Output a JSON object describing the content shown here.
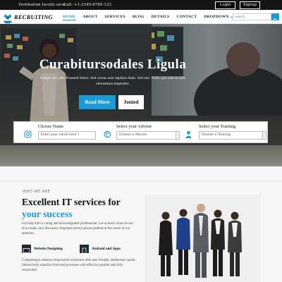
{
  "topbar": {
    "contact": "Vestibulum Iaculis arcu",
    "call": "Call: +1-2345-6789-123",
    "login": "Login",
    "signup": "Signup"
  },
  "brand": {
    "logo_text": "RECRUITING"
  },
  "nav": [
    {
      "label": "HOME",
      "active": true
    },
    {
      "label": "ABOUT"
    },
    {
      "label": "SERVICES"
    },
    {
      "label": "BLOG"
    },
    {
      "label": "DETAILS"
    },
    {
      "label": "CONTACT"
    },
    {
      "label": "DROPDOWN ⌄"
    }
  ],
  "search": {
    "placeholder": "Search"
  },
  "hero": {
    "title": "Curabitursodales Ligula",
    "subtitle": "Integer nec odio Praesent libero. Sed cursus ante dapibus diam. Sed nisi. Nulla quis sem at nibh elementum imperdiet.",
    "cta_primary": "Read More",
    "cta_secondary": "Jonied"
  },
  "search_form": {
    "name_label": "Choose Name",
    "name_value": "Enter your name here *",
    "adviser_label": "Select your Adviser",
    "adviser_value": "Choose a Adviser",
    "training_label": "Select your Training",
    "training_value": "Choose a Training"
  },
  "about": {
    "eyebrow": "WHO WE ARE",
    "heading": "Excellent IT services for",
    "heading_accent": "your success",
    "para1": "Get help from a caring and knowledgeable professional. Let us know what we can do to make your life easier. Emphasis always places patients at the center of our attention.",
    "feature1": "Website Designing",
    "feature2": "Android and Apps",
    "para2": "Compellingly embrace empowered e-business after user friendly intellectual capital. Interactively actualize front-end processes with effective parallel task fully researched."
  },
  "colors": {
    "accent": "#1a9ad6",
    "topbar": "#141414"
  }
}
